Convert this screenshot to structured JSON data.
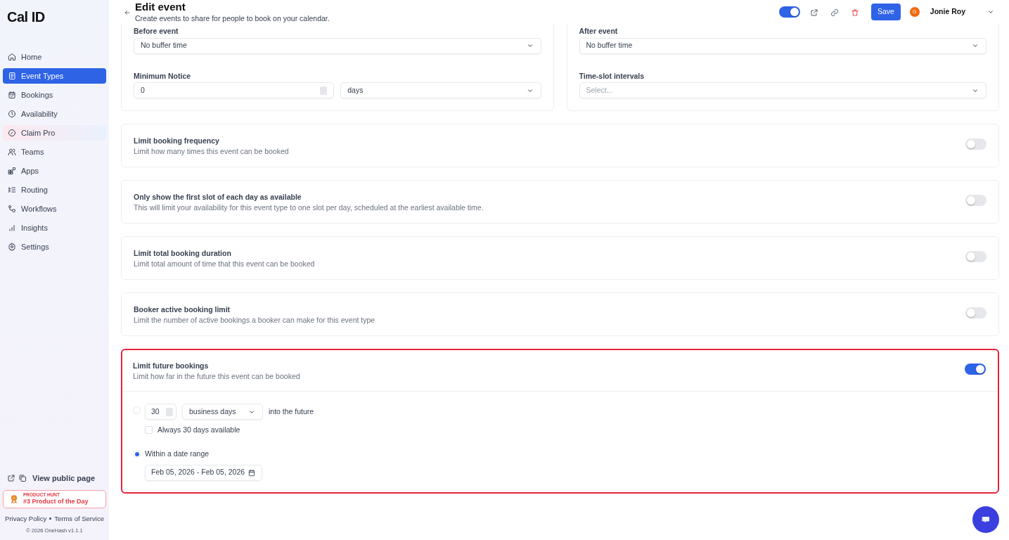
{
  "brand": "Cal ID",
  "sidebar": {
    "items": [
      {
        "label": "Home",
        "selected": false,
        "kind": "nav"
      },
      {
        "label": "Event Types",
        "selected": true,
        "kind": "nav"
      },
      {
        "label": "Bookings",
        "selected": false,
        "kind": "nav"
      },
      {
        "label": "Availability",
        "selected": false,
        "kind": "nav"
      },
      {
        "label": "Claim Pro",
        "selected": false,
        "kind": "promo"
      },
      {
        "label": "Teams",
        "selected": false,
        "kind": "nav"
      },
      {
        "label": "Apps",
        "selected": false,
        "kind": "nav"
      },
      {
        "label": "Routing",
        "selected": false,
        "kind": "nav"
      },
      {
        "label": "Workflows",
        "selected": false,
        "kind": "nav"
      },
      {
        "label": "Insights",
        "selected": false,
        "kind": "nav"
      },
      {
        "label": "Settings",
        "selected": false,
        "kind": "nav"
      }
    ],
    "public_page": "View public page",
    "product_hunt": {
      "eyebrow": "PRODUCT HUNT",
      "title": "#3 Product of the Day"
    },
    "links": [
      "Privacy Policy",
      "Terms of Service"
    ],
    "copyright": "© 2026 OneHash v1.1.1"
  },
  "header": {
    "title": "Edit event",
    "subtitle": "Create events to share for people to book on your calendar.",
    "hidden_toggle_on": true,
    "save": "Save",
    "avatar_initial": "G",
    "user_name": "Jonie Roy"
  },
  "buffers": {
    "left": [
      {
        "label": "Before event",
        "value": "No buffer time"
      },
      {
        "label": "Minimum Notice",
        "value": "0",
        "unit": "days"
      }
    ],
    "right": [
      {
        "label": "After event",
        "value": "No buffer time"
      },
      {
        "label": "Time-slot intervals",
        "placeholder": "Select..."
      }
    ]
  },
  "limits": [
    {
      "title": "Limit booking frequency",
      "description": "Limit how many times this event can be booked",
      "on": false,
      "highlighted": false
    },
    {
      "title": "Only show the first slot of each day as available",
      "description": "This will limit your availability for this event type to one slot per day, scheduled at the earliest available time.",
      "on": false,
      "highlighted": false
    },
    {
      "title": "Limit total booking duration",
      "description": "Limit total amount of time that this event can be booked",
      "on": false,
      "highlighted": false
    },
    {
      "title": "Booker active booking limit",
      "description": "Limit the number of active bookings a booker can make for this event type",
      "on": false,
      "highlighted": false
    },
    {
      "title": "Limit future bookings",
      "description": "Limit how far in the future this event can be booked",
      "on": true,
      "highlighted": true
    }
  ],
  "future": {
    "rolling": {
      "selected": false,
      "count": "30",
      "unit": "business days",
      "suffix": "into the future",
      "always_label": "Always 30 days available",
      "always_checked": false
    },
    "range": {
      "selected": true,
      "label": "Within a date range",
      "value": "Feb 05, 2026 - Feb 05, 2026"
    }
  }
}
